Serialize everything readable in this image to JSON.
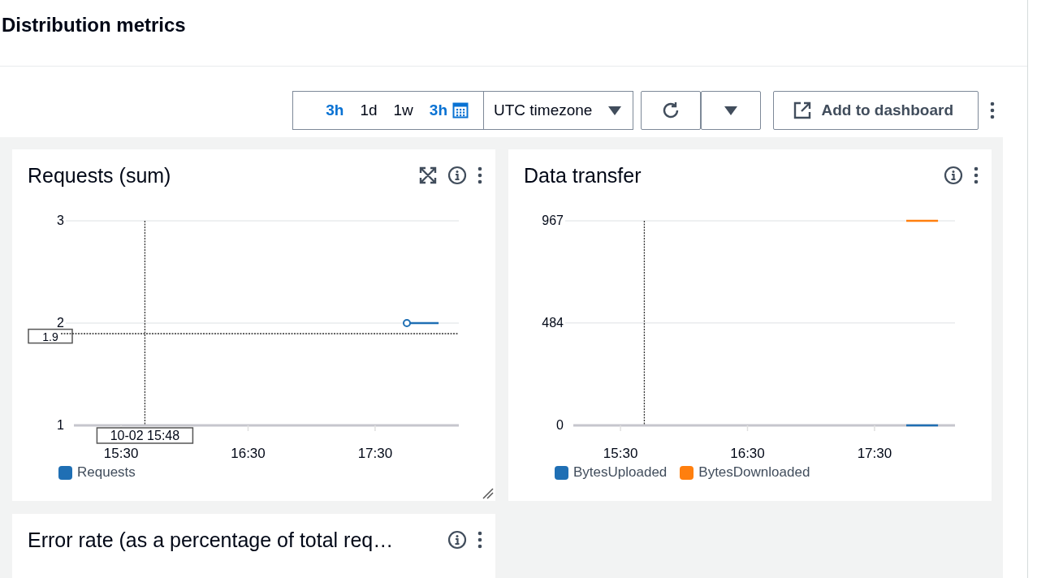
{
  "page": {
    "title": "Distribution metrics"
  },
  "toolbar": {
    "time_ranges": [
      {
        "label": "3h",
        "kind": "preset",
        "selected": true
      },
      {
        "label": "1d",
        "kind": "preset",
        "selected": false
      },
      {
        "label": "1w",
        "kind": "preset",
        "selected": false
      },
      {
        "label": "3h",
        "kind": "custom",
        "selected": true
      }
    ],
    "timezone": "UTC timezone",
    "add_button": "Add to dashboard"
  },
  "widgets": [
    {
      "title": "Requests (sum)",
      "expandable": true,
      "resizable": true,
      "point_markers": true,
      "crosshair": true,
      "crosshair_time": "10-02 15:48",
      "crosshair_value": "1.9",
      "chart_data": {
        "type": "line",
        "categories": [
          null,
          "15:30",
          null,
          null,
          null,
          "16:30",
          null,
          null,
          null,
          "17:30",
          null,
          null
        ],
        "ylim": [
          1,
          3
        ],
        "yticks": [
          1,
          2,
          3
        ],
        "series": [
          {
            "name": "Requests",
            "color": "#1f6fb4",
            "values": [
              null,
              null,
              null,
              null,
              null,
              null,
              null,
              null,
              null,
              null,
              2,
              2
            ]
          }
        ]
      }
    },
    {
      "title": "Data transfer",
      "expandable": false,
      "resizable": false,
      "point_markers": false,
      "crosshair": true,
      "chart_data": {
        "type": "line",
        "categories": [
          null,
          "15:30",
          null,
          null,
          null,
          "16:30",
          null,
          null,
          null,
          "17:30",
          null,
          null
        ],
        "ylim": [
          0,
          967
        ],
        "yticks": [
          0,
          484,
          967
        ],
        "series": [
          {
            "name": "BytesUploaded",
            "color": "#1f6fb4",
            "values": [
              null,
              null,
              null,
              null,
              null,
              null,
              null,
              null,
              null,
              null,
              0,
              0
            ]
          },
          {
            "name": "BytesDownloaded",
            "color": "#ff7f0e",
            "values": [
              null,
              null,
              null,
              null,
              null,
              null,
              null,
              null,
              null,
              null,
              967,
              967
            ]
          }
        ]
      }
    },
    {
      "title": "Error rate (as a percentage of total req…",
      "expandable": false
    }
  ]
}
